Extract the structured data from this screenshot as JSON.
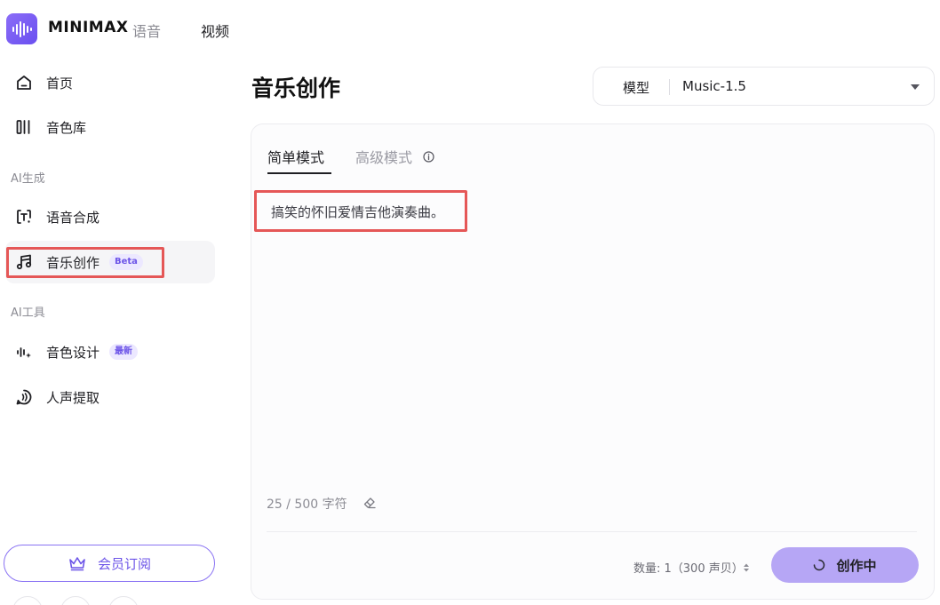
{
  "brand": {
    "name": "MINIMAX"
  },
  "top_tabs": [
    {
      "label": "语音"
    },
    {
      "label": "视频"
    }
  ],
  "sidebar": {
    "items": [
      {
        "label": "首页"
      },
      {
        "label": "音色库"
      },
      {
        "label": "语音合成"
      },
      {
        "label": "音乐创作",
        "badge": "Beta"
      },
      {
        "label": "音色设计",
        "badge": "最新"
      },
      {
        "label": "人声提取"
      }
    ],
    "sections": {
      "ai_generate": "AI生成",
      "ai_tools": "AI工具"
    },
    "member_button": "会员订阅"
  },
  "main": {
    "title": "音乐创作",
    "model": {
      "label": "模型",
      "value": "Music-1.5"
    },
    "tabs": [
      {
        "label": "简单模式"
      },
      {
        "label": "高级模式"
      }
    ],
    "prompt": "搞笑的怀旧爱情吉他演奏曲。",
    "char_count": "25 / 500 字符",
    "quantity": "数量: 1（300 声贝）",
    "create_button": "创作中"
  },
  "colors": {
    "accent": "#6d55e8",
    "highlight": "#e55757",
    "button_bg": "#b6a6f5"
  }
}
